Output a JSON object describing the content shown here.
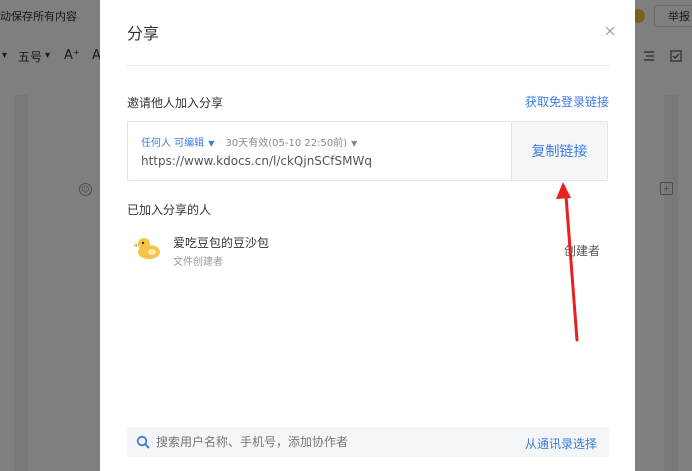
{
  "background": {
    "save_status": "动保存所有内容",
    "report_label": "举报",
    "toolbar": {
      "dropdown_caret": "▾",
      "font_size": "五号",
      "grow_font": "A⁺",
      "font_partial": "A"
    },
    "side_icons": {
      "left": "☺",
      "right": "+"
    }
  },
  "dialog": {
    "title": "分享",
    "close_glyph": "×",
    "invite_label": "邀请他人加入分享",
    "free_login_link": "获取免登录链接",
    "link": {
      "permission": "任何人 可编辑",
      "permission_caret": "▼",
      "expiry": "30天有效(05-10 22:50前)",
      "expiry_caret": "▼",
      "url": "https://www.kdocs.cn/l/ckQjnSCfSMWq",
      "copy_button": "复制链接"
    },
    "joined_label": "已加入分享的人",
    "members": [
      {
        "name": "爱吃豆包的豆沙包",
        "subtitle": "文件创建者",
        "role": "创建者"
      }
    ],
    "search": {
      "placeholder": "搜索用户名称、手机号，添加协作者",
      "contacts_link": "从通讯录选择"
    }
  },
  "colors": {
    "accent": "#3c7ce0",
    "annotation": "#e8201f",
    "overlay": "rgba(0,0,0,0.5)"
  }
}
